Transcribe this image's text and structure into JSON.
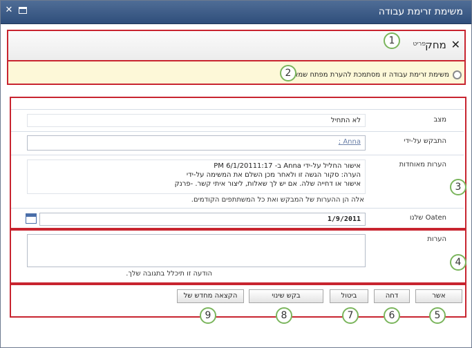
{
  "window": {
    "title": "משימת זרימת עבודה",
    "close_glyph": "✕"
  },
  "ribbon": {
    "delete_label": "מחק",
    "item_tab_label": "פריט"
  },
  "status": {
    "message": "משימת זרימת עבודה זו מסתמכת להערת מפתח שמאלה."
  },
  "form": {
    "status": {
      "label": "מצב",
      "value": "לא התחיל"
    },
    "requested_by": {
      "label": "התבקש על-ידי",
      "value": "Anna ;"
    },
    "consolidated_comments": {
      "label": "הערות מאוחדות",
      "line1": "אישור החליל על-ידי Anna ב- 6/1/20111:17 PM",
      "line2": "הערה: סקור הגשה זו ולאחר מכן השלם את המשימה על-ידי",
      "line3": "אישור או דחייה שלה. אם יש לך שאלות, ליצור איתי קשר. -פרנק",
      "note": "אלה הן ההערות של המבקש ואת כל המשתתפים הקודמים."
    },
    "due_date": {
      "label": "Oaten שלנו",
      "value": "1/9/2011"
    }
  },
  "comments": {
    "label": "הערות",
    "value": "",
    "hint": "הודעה זו תיכלל בתגובה שלך."
  },
  "buttons": {
    "approve": "אשר",
    "reject": "דחה",
    "cancel": "ביטול",
    "request_change": "בקש שינוי",
    "reassign": "הקצאה מחדש של פעילות"
  },
  "callouts": [
    "1",
    "2",
    "3",
    "4",
    "5",
    "6",
    "7",
    "8",
    "9"
  ]
}
